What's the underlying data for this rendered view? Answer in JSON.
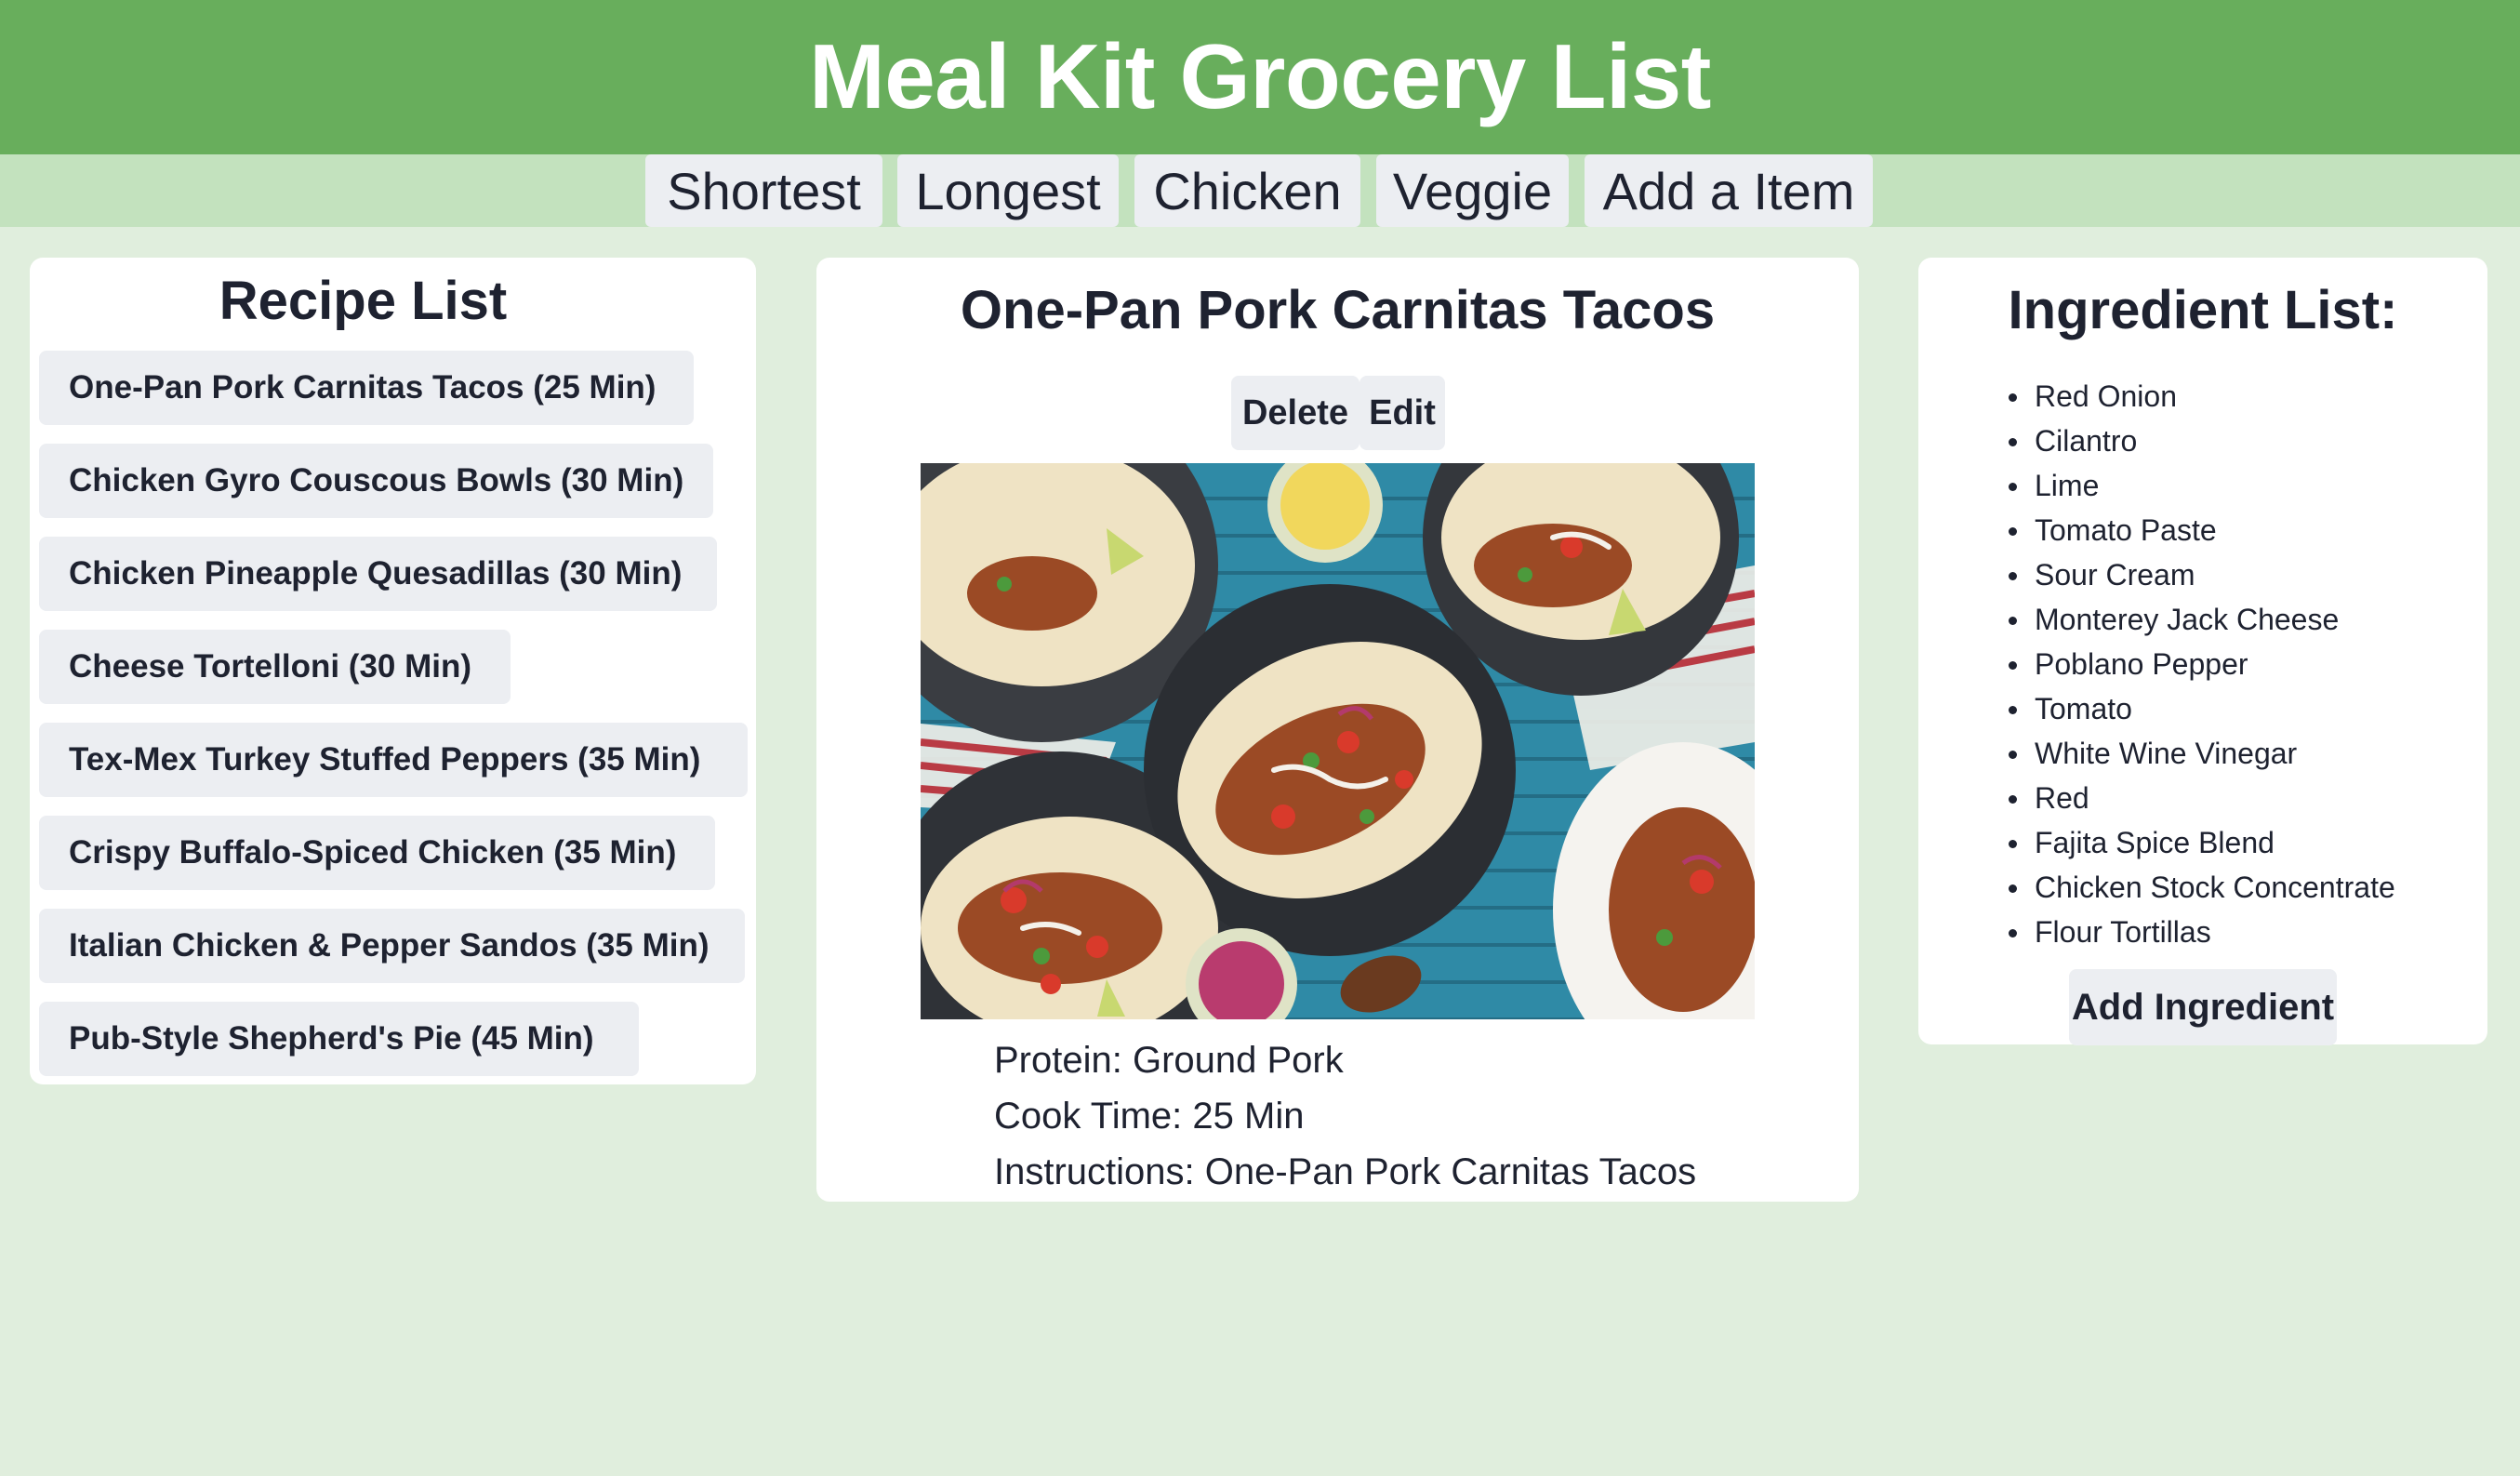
{
  "header": {
    "title": "Meal Kit Grocery List"
  },
  "nav": [
    "Shortest",
    "Longest",
    "Chicken",
    "Veggie",
    "Add a Item"
  ],
  "recipe_list": {
    "title": "Recipe List",
    "items": [
      "One-Pan Pork Carnitas Tacos (25 Min)",
      "Chicken Gyro Couscous Bowls (30 Min)",
      "Chicken Pineapple Quesadillas (30 Min)",
      "Cheese Tortelloni (30 Min)",
      "Tex-Mex Turkey Stuffed Peppers (35 Min)",
      "Crispy Buffalo-Spiced Chicken (35 Min)",
      "Italian Chicken & Pepper Sandos (35 Min)",
      "Pub-Style Shepherd's Pie (45 Min)"
    ]
  },
  "detail": {
    "title": "One-Pan Pork Carnitas Tacos",
    "delete_label": "Delete",
    "edit_label": "Edit",
    "protein": "Protein: Ground Pork",
    "cook_time": "Cook Time: 25 Min",
    "instructions": "Instructions: One-Pan Pork Carnitas Tacos"
  },
  "ingredients": {
    "title": "Ingredient List:",
    "items": [
      "Red Onion",
      "Cilantro",
      "Lime",
      "Tomato Paste",
      "Sour Cream",
      "Monterey Jack Cheese",
      "Poblano Pepper",
      "Tomato",
      "White Wine Vinegar",
      "Red",
      "Fajita Spice Blend",
      "Chicken Stock Concentrate",
      "Flour Tortillas"
    ],
    "add_label": "Add Ingredient"
  },
  "colors": {
    "header_green": "#68ae5c",
    "nav_green": "#c3e2be",
    "page_bg": "#e0eedd",
    "button_gray": "#eceef2"
  }
}
